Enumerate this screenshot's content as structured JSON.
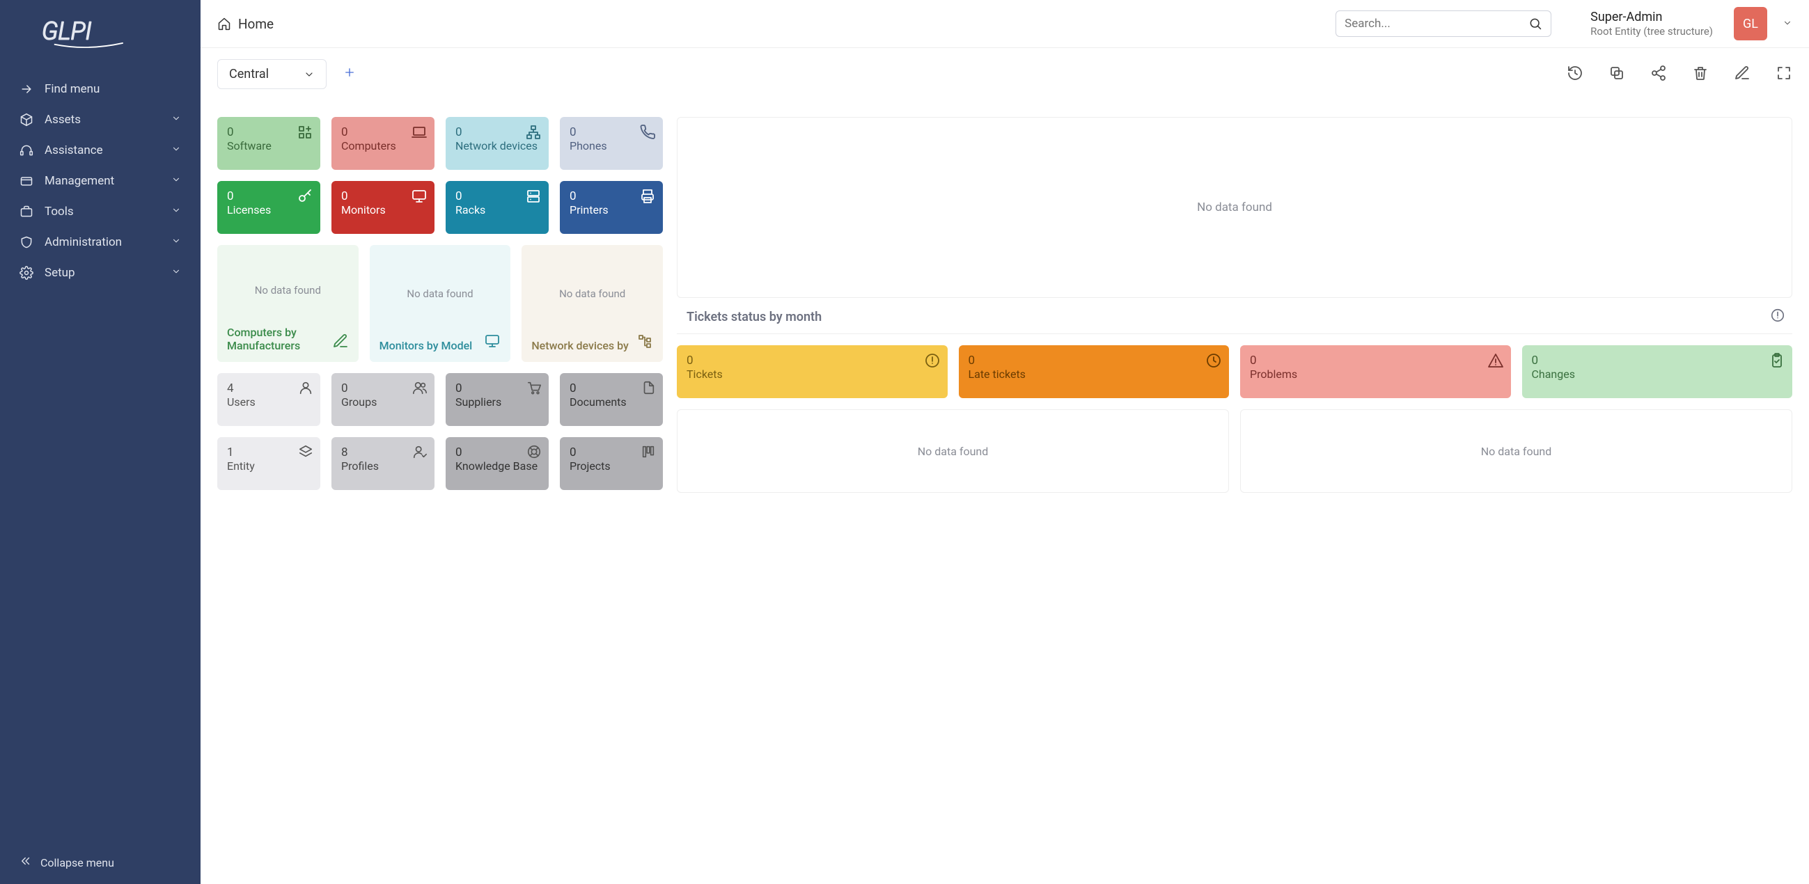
{
  "app": {
    "name": "GLPI"
  },
  "topbar": {
    "home": "Home",
    "search_placeholder": "Search...",
    "user_name": "Super-Admin",
    "entity": "Root Entity (tree structure)",
    "avatar_initials": "GL"
  },
  "sidebar": {
    "find_menu": "Find menu",
    "items": [
      {
        "label": "Assets"
      },
      {
        "label": "Assistance"
      },
      {
        "label": "Management"
      },
      {
        "label": "Tools"
      },
      {
        "label": "Administration"
      },
      {
        "label": "Setup"
      }
    ],
    "collapse": "Collapse menu"
  },
  "header": {
    "dropdown": "Central"
  },
  "tiles": [
    {
      "count": "0",
      "label": "Software",
      "cls": "tile-green-l",
      "icon": "grid-plus"
    },
    {
      "count": "0",
      "label": "Computers",
      "cls": "tile-red-l",
      "icon": "laptop"
    },
    {
      "count": "0",
      "label": "Network devices",
      "cls": "tile-blue-l",
      "icon": "network"
    },
    {
      "count": "0",
      "label": "Phones",
      "cls": "tile-gray-l",
      "icon": "phone"
    },
    {
      "count": "0",
      "label": "Licenses",
      "cls": "tile-green",
      "icon": "key"
    },
    {
      "count": "0",
      "label": "Monitors",
      "cls": "tile-red",
      "icon": "monitor"
    },
    {
      "count": "0",
      "label": "Racks",
      "cls": "tile-teal",
      "icon": "server"
    },
    {
      "count": "0",
      "label": "Printers",
      "cls": "tile-blue",
      "icon": "printer"
    }
  ],
  "nodata_cards": [
    {
      "msg": "No data found",
      "title": "Computers by Manufacturers",
      "cls": "nd-green",
      "icon": "edit"
    },
    {
      "msg": "No data found",
      "title": "Monitors by Model",
      "cls": "nd-teal",
      "icon": "monitor"
    },
    {
      "msg": "No data found",
      "title": "Network devices by",
      "cls": "nd-brown",
      "icon": "tree"
    }
  ],
  "info_cards": [
    {
      "count": "4",
      "label": "Users",
      "cls": "ic-gray-l",
      "icon": "user"
    },
    {
      "count": "0",
      "label": "Groups",
      "cls": "ic-gray",
      "icon": "users"
    },
    {
      "count": "0",
      "label": "Suppliers",
      "cls": "ic-gray-d",
      "icon": "cart"
    },
    {
      "count": "0",
      "label": "Documents",
      "cls": "ic-gray-d",
      "icon": "files"
    },
    {
      "count": "1",
      "label": "Entity",
      "cls": "ic-gray-l",
      "icon": "layers"
    },
    {
      "count": "8",
      "label": "Profiles",
      "cls": "ic-gray",
      "icon": "user-check"
    },
    {
      "count": "0",
      "label": "Knowledge Base",
      "cls": "ic-gray-d",
      "icon": "lifebuoy"
    },
    {
      "count": "0",
      "label": "Projects",
      "cls": "ic-gray-d",
      "icon": "kanban"
    }
  ],
  "right": {
    "big_nodata": "No data found",
    "section_title": "Tickets status by month",
    "status": [
      {
        "count": "0",
        "label": "Tickets",
        "cls": "sc-yellow",
        "icon": "alert"
      },
      {
        "count": "0",
        "label": "Late tickets",
        "cls": "sc-orange",
        "icon": "clock"
      },
      {
        "count": "0",
        "label": "Problems",
        "cls": "sc-red-l",
        "icon": "warning"
      },
      {
        "count": "0",
        "label": "Changes",
        "cls": "sc-green-l",
        "icon": "clipboard"
      }
    ],
    "nodata2": [
      {
        "msg": "No data found"
      },
      {
        "msg": "No data found"
      }
    ]
  }
}
